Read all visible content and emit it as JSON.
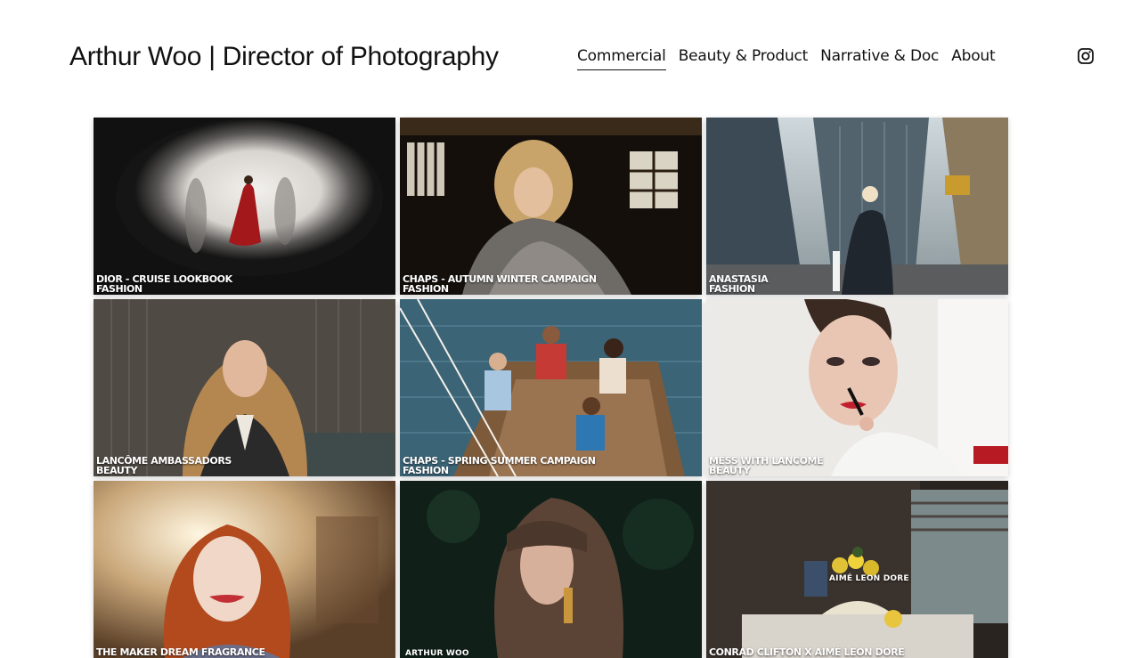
{
  "header": {
    "title": "Arthur Woo  |  Director of Photography",
    "nav": [
      {
        "label": "Commercial",
        "active": true
      },
      {
        "label": "Beauty & Product",
        "active": false
      },
      {
        "label": "Narrative & Doc",
        "active": false
      },
      {
        "label": "About",
        "active": false
      }
    ],
    "social_icon": "instagram-icon"
  },
  "tiles": [
    {
      "title": "DIOR - CRUISE LOOKBOOK",
      "category": "FASHION"
    },
    {
      "title": "CHAPS - AUTUMN WINTER CAMPAIGN",
      "category": "FASHION"
    },
    {
      "title": "ANASTASIA",
      "category": "FASHION"
    },
    {
      "title": "LANCÔME AMBASSADORS",
      "category": "BEAUTY"
    },
    {
      "title": "CHAPS - SPRING SUMMER CAMPAIGN",
      "category": "FASHION"
    },
    {
      "title": "MESS WITH LANCOME",
      "category": "BEAUTY"
    },
    {
      "title": "THE MAKER DREAM FRAGRANCE",
      "category": ""
    },
    {
      "title": "ARTHUR WOO",
      "category": ""
    },
    {
      "title": "CONRAD CLIFTON X AIMÉ LEON DORE",
      "category": ""
    }
  ],
  "watermarks": {
    "aime": "AIMÉ LEON DORE"
  },
  "colors": {
    "text": "#111111",
    "background": "#ffffff"
  }
}
